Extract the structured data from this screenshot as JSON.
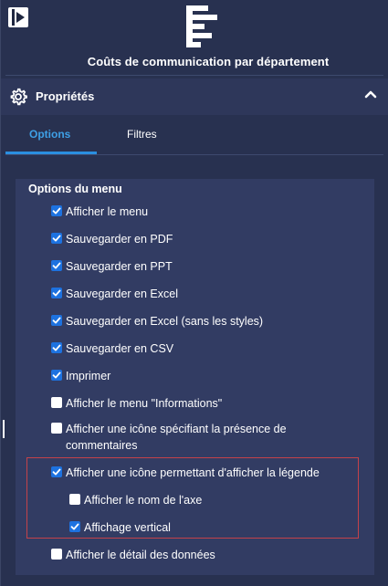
{
  "header": {
    "chart_title": "Coûts de communication par département"
  },
  "properties": {
    "title": "Propriétés",
    "icons": {
      "settings": "gear-icon",
      "collapse": "chevron-up-icon"
    }
  },
  "tabs": [
    {
      "label": "Options",
      "active": true
    },
    {
      "label": "Filtres",
      "active": false
    }
  ],
  "menu_options": {
    "heading": "Options du menu",
    "items": [
      {
        "label": "Afficher le menu",
        "checked": true
      },
      {
        "label": "Sauvegarder en PDF",
        "checked": true
      },
      {
        "label": "Sauvegarder en PPT",
        "checked": true
      },
      {
        "label": "Sauvegarder en Excel",
        "checked": true
      },
      {
        "label": "Sauvegarder en Excel (sans les styles)",
        "checked": true
      },
      {
        "label": "Sauvegarder en CSV",
        "checked": true
      },
      {
        "label": "Imprimer",
        "checked": true
      },
      {
        "label": "Afficher le menu \"Informations\"",
        "checked": false
      },
      {
        "label": "Afficher une icône spécifiant la présence de commentaires",
        "checked": false
      },
      {
        "label": "Afficher une icône permettant d'afficher la légende",
        "checked": true
      },
      {
        "label": "Afficher le nom de l'axe",
        "checked": false
      },
      {
        "label": "Affichage vertical",
        "checked": true
      },
      {
        "label": "Afficher le détail des données",
        "checked": false
      }
    ]
  },
  "colors": {
    "background": "#283150",
    "card": "#323c63",
    "accent": "#3ea0e6",
    "checkbox_checked": "#1d72e0",
    "highlight_border": "#c4424a"
  }
}
